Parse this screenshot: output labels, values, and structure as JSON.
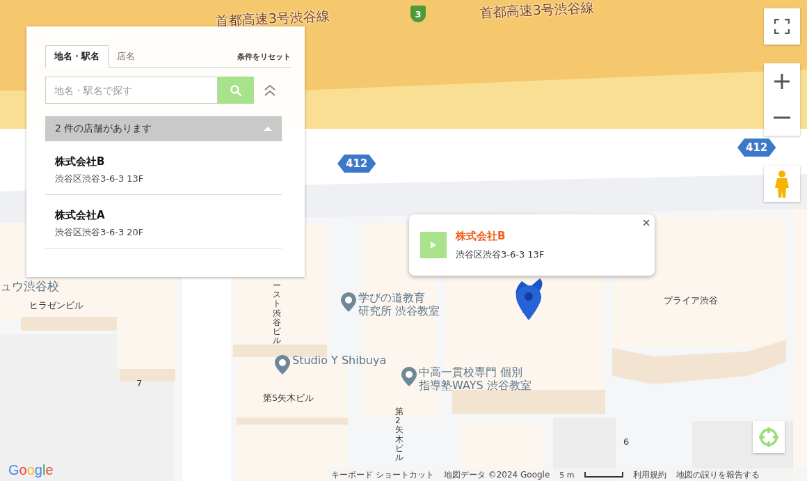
{
  "map": {
    "road_names": [
      "首都高速3号渋谷線",
      "首都高速3号渋谷線"
    ],
    "shields": [
      {
        "kind": "expressway",
        "text": "3"
      },
      {
        "kind": "route",
        "text": "412"
      },
      {
        "kind": "route",
        "text": "412"
      }
    ],
    "labels": [
      {
        "kind": "place",
        "lines": [
          "ュウ渋谷校"
        ]
      },
      {
        "kind": "building",
        "lines": [
          "ヒラゼンビル"
        ]
      },
      {
        "kind": "building",
        "lines": [
          "7"
        ]
      },
      {
        "kind": "poi",
        "lines": [
          "学びの道教育",
          "研究所 渋谷教室"
        ]
      },
      {
        "kind": "poi",
        "lines": [
          "Studio Y Shibuya"
        ]
      },
      {
        "kind": "poi",
        "lines": [
          "中高一貫校専門 個別",
          "指導塾WAYS 渋谷教室"
        ]
      },
      {
        "kind": "building",
        "lines": [
          "第5矢木ビル"
        ]
      },
      {
        "kind": "building",
        "lines": [
          "プライア渋谷"
        ]
      },
      {
        "kind": "building",
        "lines": [
          "6"
        ]
      },
      {
        "kind": "vertical",
        "lines": [
          "ースト渋谷ビル"
        ]
      },
      {
        "kind": "vertical",
        "lines": [
          "第2矢木ビル"
        ]
      }
    ]
  },
  "controls": {
    "logo": "Google",
    "footer": [
      "キーボード ショートカット",
      "地図データ ©2024 Google",
      "5 m",
      "利用規約",
      "地図の誤りを報告する"
    ]
  },
  "panel": {
    "tabs": [
      {
        "label": "地名・駅名",
        "selected": true
      },
      {
        "label": "店名",
        "selected": false
      }
    ],
    "reset": "条件をリセット",
    "search": {
      "placeholder": "地名・駅名で探す"
    },
    "results": {
      "header": "2 件の店舗があります",
      "expanded": true,
      "items": [
        {
          "name": "株式会社B",
          "address": "渋谷区渋谷3-6-3 13F"
        },
        {
          "name": "株式会社A",
          "address": "渋谷区渋谷3-6-3 20F"
        }
      ]
    }
  },
  "info_window": {
    "title": "株式会社B",
    "address": "渋谷区渋谷3-6-3 13F"
  }
}
